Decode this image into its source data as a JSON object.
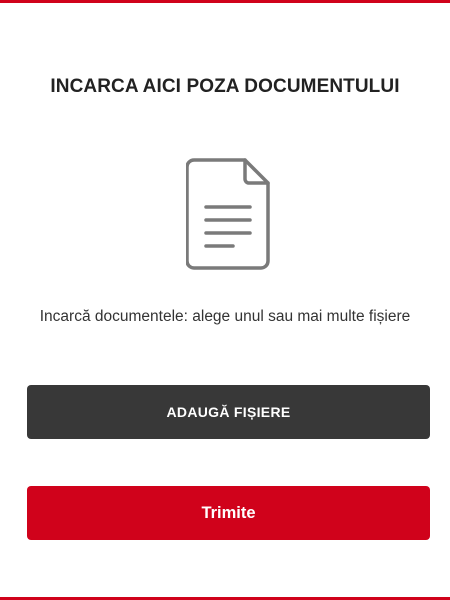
{
  "upload": {
    "title": "INCARCA AICI POZA DOCUMENTULUI",
    "instructions": "Incarcă documentele: alege unul sau mai multe fișiere",
    "document_icon": "document-icon",
    "add_files_label": "ADAUGĂ FIȘIERE",
    "submit_label": "Trimite"
  },
  "colors": {
    "brand_red": "#d0021b",
    "dark_button": "#383838",
    "icon_gray": "#7a7a7a",
    "title_text": "#222222"
  }
}
